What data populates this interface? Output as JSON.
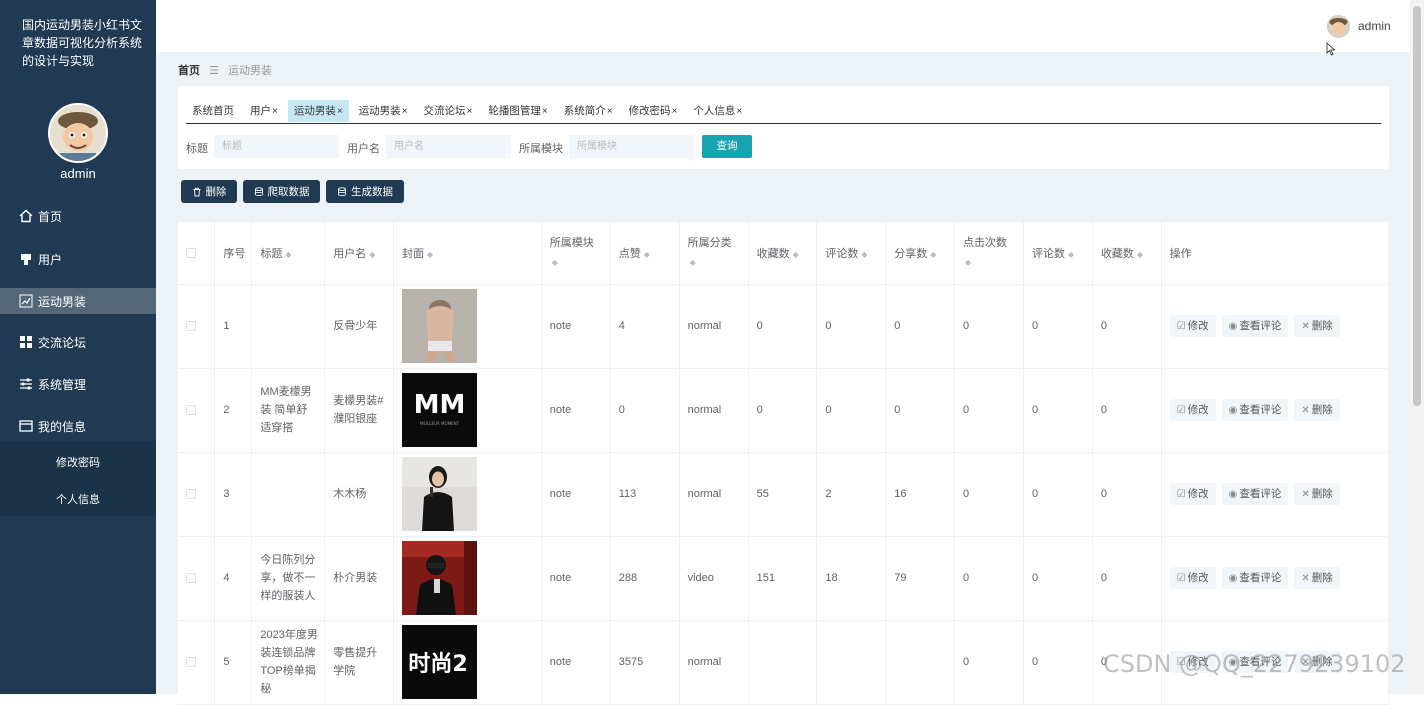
{
  "sidebar": {
    "app_title": "国内运动男装小红书文章数据可视化分析系统的设计与实现",
    "username": "admin",
    "menu": [
      {
        "label": "首页",
        "icon": "home-icon"
      },
      {
        "label": "用户",
        "icon": "user-icon"
      },
      {
        "label": "运动男装",
        "icon": "chart-icon",
        "active": true
      },
      {
        "label": "交流论坛",
        "icon": "grid-icon"
      },
      {
        "label": "系统管理",
        "icon": "sliders-icon"
      },
      {
        "label": "我的信息",
        "icon": "card-icon"
      }
    ],
    "submenu": [
      "修改密码",
      "个人信息"
    ]
  },
  "header": {
    "username": "admin"
  },
  "breadcrumb": {
    "home": "首页",
    "separator": "☰",
    "current": "运动男装"
  },
  "tabs": [
    {
      "label": "系统首页",
      "closable": false
    },
    {
      "label": "用户",
      "closable": true
    },
    {
      "label": "运动男装",
      "closable": true,
      "active": true
    },
    {
      "label": "运动男装",
      "closable": true
    },
    {
      "label": "交流论坛",
      "closable": true
    },
    {
      "label": "轮播图管理",
      "closable": true
    },
    {
      "label": "系统简介",
      "closable": true
    },
    {
      "label": "修改密码",
      "closable": true
    },
    {
      "label": "个人信息",
      "closable": true
    }
  ],
  "search": {
    "title_label": "标题",
    "title_placeholder": "标题",
    "username_label": "用户名",
    "username_placeholder": "用户名",
    "module_label": "所属模块",
    "module_placeholder": "所属模块",
    "query_button": "查询"
  },
  "actions": {
    "delete": "删除",
    "crawl": "爬取数据",
    "generate": "生成数据"
  },
  "table": {
    "headers": [
      "序号",
      "标题",
      "用户名",
      "封面",
      "所属模块",
      "点赞",
      "所属分类",
      "收藏数",
      "评论数",
      "分享数",
      "点击次数",
      "评论数",
      "收藏数",
      "操作"
    ],
    "rows": [
      {
        "no": "1",
        "title": "",
        "user": "反骨少年",
        "cover": "photo-figure",
        "module": "note",
        "likes": "4",
        "category": "normal",
        "fav": "0",
        "comments": "0",
        "shares": "0",
        "clicks": "0",
        "comments2": "0",
        "fav2": "0"
      },
      {
        "no": "2",
        "title": "MM麦檬男装 简单舒适穿搭",
        "user": "麦檬男装#濮阳银座",
        "cover": "logo-mm",
        "module": "note",
        "likes": "0",
        "category": "normal",
        "fav": "0",
        "comments": "0",
        "shares": "0",
        "clicks": "0",
        "comments2": "0",
        "fav2": "0"
      },
      {
        "no": "3",
        "title": "",
        "user": "木木杨",
        "cover": "photo-speaker",
        "module": "note",
        "likes": "113",
        "category": "normal",
        "fav": "55",
        "comments": "2",
        "shares": "16",
        "clicks": "0",
        "comments2": "0",
        "fav2": "0"
      },
      {
        "no": "4",
        "title": "今日陈列分享，做不一样的服装人",
        "user": "朴介男装",
        "cover": "photo-red",
        "module": "note",
        "likes": "288",
        "category": "video",
        "fav": "151",
        "comments": "18",
        "shares": "79",
        "clicks": "0",
        "comments2": "0",
        "fav2": "0"
      },
      {
        "no": "5",
        "title": "2023年度男装连锁品牌TOP榜单揭秘",
        "user": "零售提升学院",
        "cover": "text-fashion",
        "module": "note",
        "likes": "3575",
        "category": "normal",
        "fav": "",
        "comments": "",
        "shares": "",
        "clicks": "0",
        "comments2": "0",
        "fav2": "0"
      }
    ],
    "op_edit": "修改",
    "op_view": "查看评论",
    "op_delete": "删除",
    "cover_mm_text": "MM",
    "cover_mm_sub": "MEILLEUR MOMENT",
    "cover_fashion_text": "时尚2"
  },
  "watermark": "CSDN @QQ_2279239102",
  "colors": {
    "sidebar": "#1f3a52",
    "accent": "#17a3b0",
    "active_tab": "#c6e8f5",
    "background": "#edf2f7"
  }
}
